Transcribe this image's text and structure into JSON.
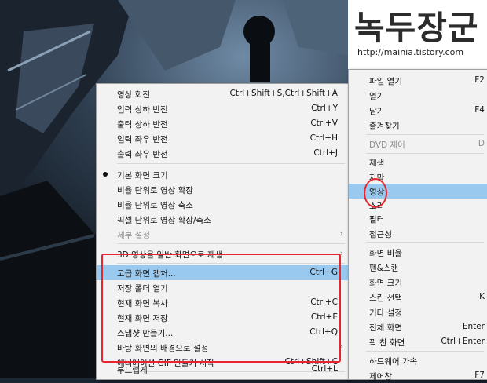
{
  "watermark": {
    "title": "녹두장군",
    "url": "http://mainia.tistory.com"
  },
  "submenu": [
    {
      "label": "영상 회전",
      "shortcut": "Ctrl+Shift+S,Ctrl+Shift+A"
    },
    {
      "label": "입력 상하 반전",
      "shortcut": "Ctrl+Y"
    },
    {
      "label": "출력 상하 반전",
      "shortcut": "Ctrl+V"
    },
    {
      "label": "입력 좌우 반전",
      "shortcut": "Ctrl+H"
    },
    {
      "label": "출력 좌우 반전",
      "shortcut": "Ctrl+J"
    },
    {
      "label": "기본 화면 크기",
      "shortcut": "",
      "checked": true
    },
    {
      "label": "비율 단위로 영상 확장",
      "shortcut": ""
    },
    {
      "label": "비율 단위로 영상 축소",
      "shortcut": ""
    },
    {
      "label": "픽셀 단위로 영상 확장/축소",
      "shortcut": ""
    },
    {
      "label": "세부 설정",
      "shortcut": "",
      "disabled": true,
      "submenu": true
    },
    {
      "label": "3D 영상을 일반 화면으로 재생",
      "shortcut": "",
      "submenu": true
    },
    {
      "label": "고급 화면 캡처...",
      "shortcut": "Ctrl+G",
      "highlighted": true
    },
    {
      "label": "저장 폴더 열기",
      "shortcut": ""
    },
    {
      "label": "현재 화면 복사",
      "shortcut": "Ctrl+C"
    },
    {
      "label": "현재 화면 저장",
      "shortcut": "Ctrl+E"
    },
    {
      "label": "스냅샷 만들기...",
      "shortcut": "Ctrl+Q"
    },
    {
      "label": "바탕 화면의 배경으로 설정",
      "shortcut": "",
      "submenu": true
    },
    {
      "label": "애니메이션 GIF 만들기 시작",
      "shortcut": "Ctrl+Shift+C"
    },
    {
      "label": "부드럽게",
      "shortcut": "Ctrl+L"
    }
  ],
  "mainmenu": [
    {
      "label": "파일 열기",
      "shortcut": "F2"
    },
    {
      "label": "열기",
      "shortcut": ""
    },
    {
      "label": "닫기",
      "shortcut": "F4"
    },
    {
      "label": "즐겨찾기",
      "shortcut": ""
    },
    {
      "label": "DVD 제어",
      "shortcut": "D",
      "disabled": true
    },
    {
      "label": "재생",
      "shortcut": ""
    },
    {
      "label": "자막",
      "shortcut": ""
    },
    {
      "label": "영상",
      "shortcut": "",
      "highlighted": true
    },
    {
      "label": "소리",
      "shortcut": ""
    },
    {
      "label": "필터",
      "shortcut": ""
    },
    {
      "label": "접근성",
      "shortcut": ""
    },
    {
      "label": "화면 비율",
      "shortcut": ""
    },
    {
      "label": "팬&스캔",
      "shortcut": ""
    },
    {
      "label": "화면 크기",
      "shortcut": ""
    },
    {
      "label": "스킨 선택",
      "shortcut": "K"
    },
    {
      "label": "기타 설정",
      "shortcut": ""
    },
    {
      "label": "전체 화면",
      "shortcut": "Enter"
    },
    {
      "label": "꽉 찬 화면",
      "shortcut": "Ctrl+Enter"
    },
    {
      "label": "하드웨어 가속",
      "shortcut": ""
    },
    {
      "label": "제어창",
      "shortcut": "F7"
    }
  ]
}
